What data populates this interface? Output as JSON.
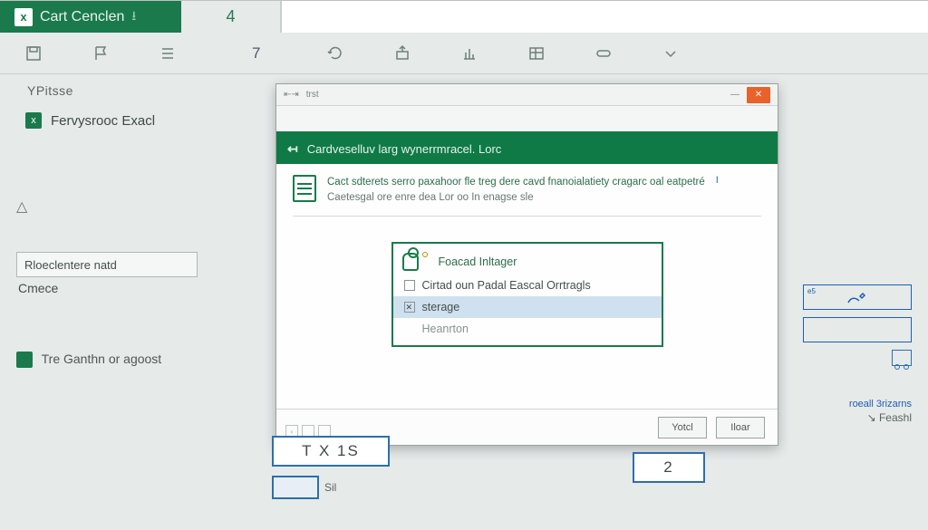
{
  "colors": {
    "brand_green": "#1a7a4c",
    "accent_orange": "#e8622a",
    "accent_blue": "#1f5fae"
  },
  "titlebar": {
    "app_glyph": "x",
    "title": "Cart Cenclen",
    "download_glyph": "⭳"
  },
  "formula": {
    "cell_value": "4"
  },
  "ribbon": {
    "second_number": "7"
  },
  "left_panel": {
    "section_label": "YPitsse",
    "item1": "Fervysrooc Exacl",
    "warn_glyph": "△",
    "input_value": "Rloeclentere natd",
    "sub_label": "Cmece",
    "footer_text": "Tre Ganthn or agoost"
  },
  "dialog": {
    "title_mini": "trst",
    "header_text": "Cardveselluv larg wynerrmracel. Lorc",
    "desc_line1": "Cact sdterets serro paxahoor fle treg dere cavd fnanoialatiety cragarc oal eatpetré",
    "desc_line2": "Caetesgal ore enre dea Lor oo In enagse sle",
    "desc_link": "I",
    "options": {
      "header": "Foacad Inltager",
      "row1": "Cirtad oun Padal Eascal Orrtragls",
      "row2": "sterage",
      "row3": "Heanrton"
    },
    "buttons": {
      "primary": "Yotcl",
      "secondary": "Iloar"
    }
  },
  "right": {
    "tag": "e5",
    "footer_small1": "roeall 3rizarns",
    "footer_small2": "Feashl"
  },
  "bottom": {
    "cell1": "T X 1S",
    "cell2": "2",
    "small_label": "Sil"
  }
}
